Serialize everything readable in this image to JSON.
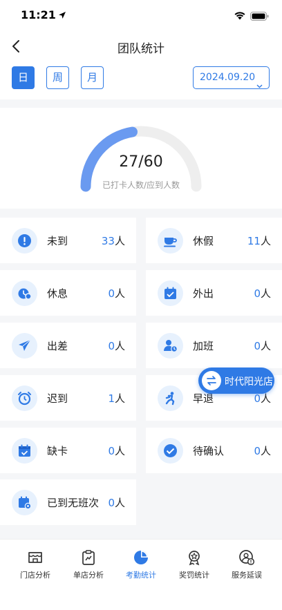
{
  "status_bar": {
    "time": "11:21"
  },
  "header": {
    "title": "团队统计"
  },
  "period_tabs": [
    {
      "label": "日",
      "active": true
    },
    {
      "label": "周",
      "active": false
    },
    {
      "label": "月",
      "active": false
    }
  ],
  "date_selector": {
    "value": "2024.09.20"
  },
  "summary": {
    "checked_in": 27,
    "expected": 60,
    "ratio_text": "27/60",
    "subtitle": "已打卡人数/应到人数"
  },
  "stats": [
    {
      "label": "未到",
      "count": "33",
      "unit": "人",
      "icon": "exclamation-icon"
    },
    {
      "label": "休假",
      "count": "11",
      "unit": "人",
      "icon": "coffee-cup-icon"
    },
    {
      "label": "休息",
      "count": "0",
      "unit": "人",
      "icon": "rest-icon"
    },
    {
      "label": "外出",
      "count": "0",
      "unit": "人",
      "icon": "calendar-out-icon"
    },
    {
      "label": "出差",
      "count": "0",
      "unit": "人",
      "icon": "airplane-icon"
    },
    {
      "label": "加班",
      "count": "0",
      "unit": "人",
      "icon": "person-clock-icon"
    },
    {
      "label": "迟到",
      "count": "1",
      "unit": "人",
      "icon": "alarm-clock-icon"
    },
    {
      "label": "早退",
      "count": "0",
      "unit": "人",
      "icon": "running-person-icon"
    },
    {
      "label": "缺卡",
      "count": "0",
      "unit": "人",
      "icon": "calendar-check-icon"
    },
    {
      "label": "待确认",
      "count": "0",
      "unit": "人",
      "icon": "checkmark-icon"
    },
    {
      "label": "已到无班次",
      "count": "0",
      "unit": "人",
      "icon": "calendar-gear-icon"
    }
  ],
  "store_switch": {
    "label": "时代阳光店"
  },
  "tabbar": [
    {
      "label": "门店分析",
      "icon": "store-icon",
      "active": false
    },
    {
      "label": "单店分析",
      "icon": "clipboard-chart-icon",
      "active": false
    },
    {
      "label": "考勤统计",
      "icon": "pie-chart-icon",
      "active": true
    },
    {
      "label": "奖罚统计",
      "icon": "medal-icon",
      "active": false
    },
    {
      "label": "服务延误",
      "icon": "user-alert-icon",
      "active": false
    }
  ],
  "colors": {
    "accent": "#2f7ae5",
    "icon_bg": "#e7f1fd",
    "track": "#eeeeee",
    "background": "#f5f6f8"
  }
}
